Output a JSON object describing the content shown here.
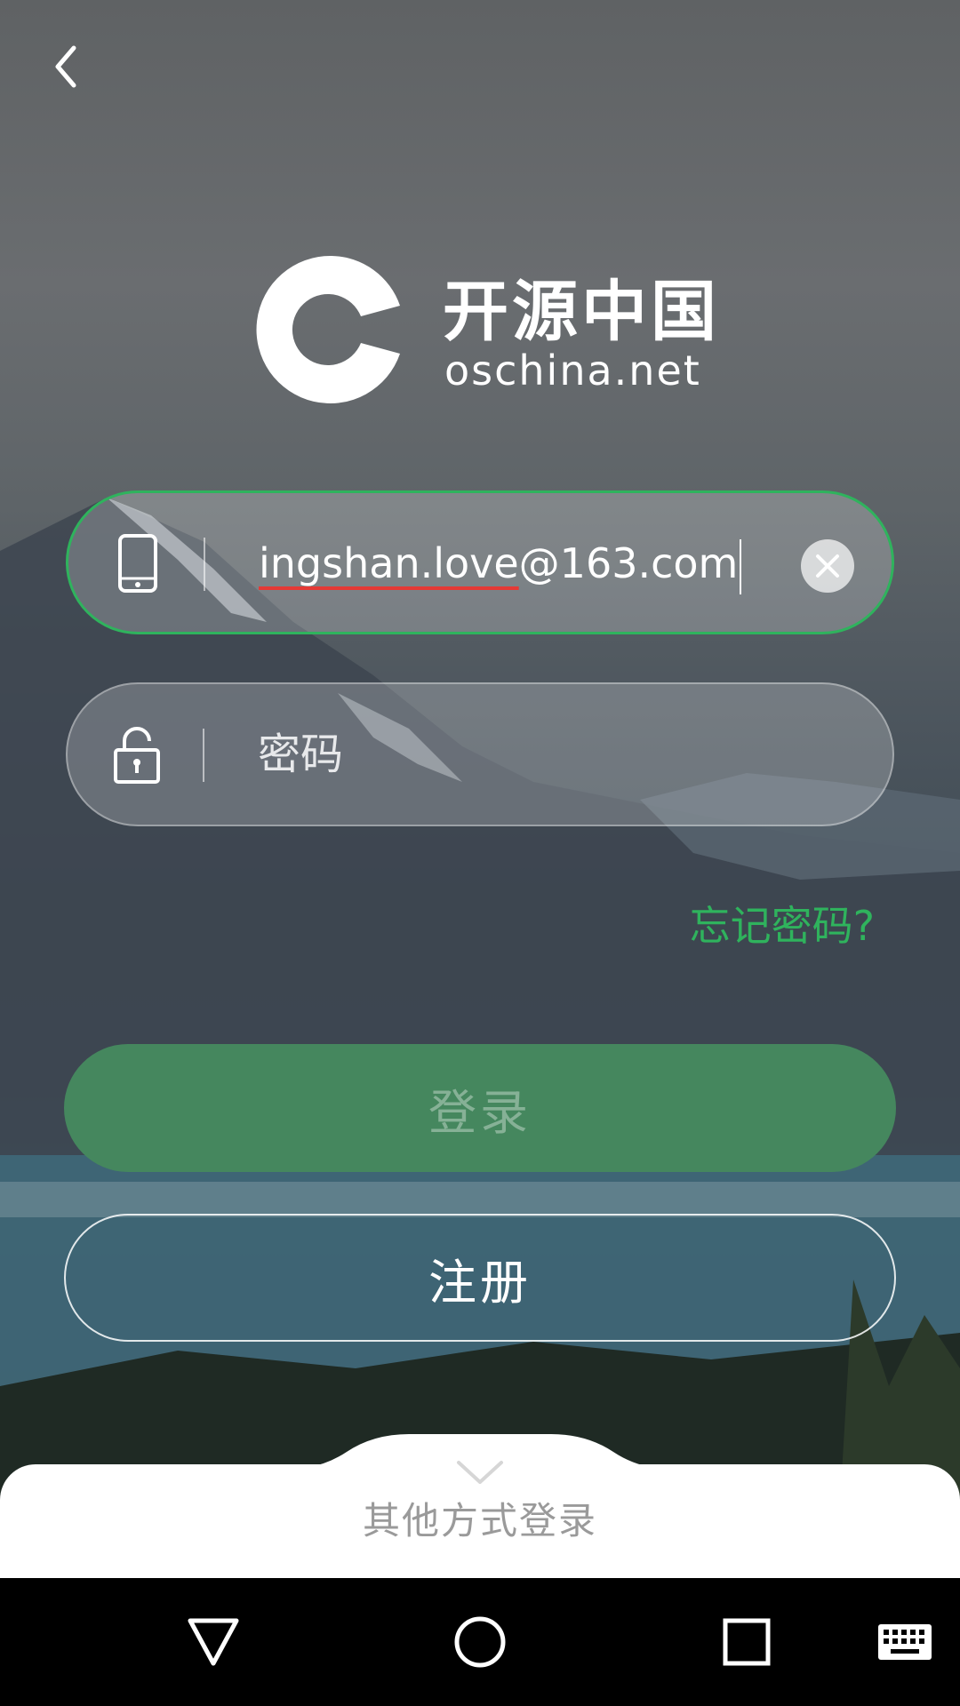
{
  "header": {
    "back_icon": "chevron-left-icon"
  },
  "logo": {
    "title": "开源中国",
    "subtitle": "oschina.net"
  },
  "form": {
    "account": {
      "icon": "phone-icon",
      "value_underlined": "ingshan.love",
      "value_rest": "@163.com",
      "clear_icon": "close-icon"
    },
    "password": {
      "icon": "lock-icon",
      "placeholder": "密码"
    },
    "forgot_label": "忘记密码?",
    "login_label": "登录",
    "register_label": "注册"
  },
  "bottom_sheet": {
    "label": "其他方式登录",
    "icon": "chevron-down-icon"
  },
  "navbar": {
    "back": "triangle-back-icon",
    "home": "circle-home-icon",
    "recents": "square-recents-icon",
    "keyboard": "keyboard-icon"
  },
  "colors": {
    "accent": "#2fb35d",
    "login_button": "#45875e"
  }
}
